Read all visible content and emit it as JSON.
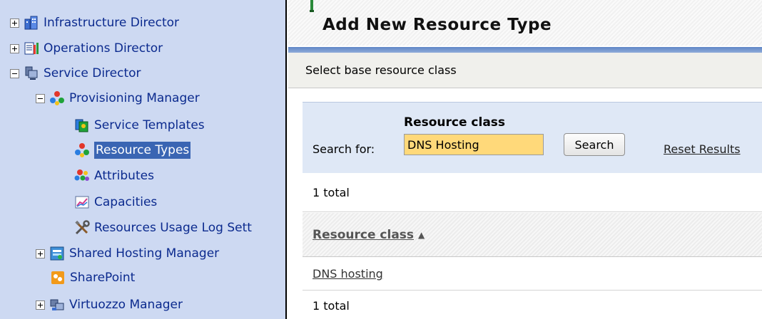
{
  "tree": {
    "items": [
      {
        "label": "Infrastructure Director",
        "icon": "building-icon"
      },
      {
        "label": "Operations Director",
        "icon": "operations-icon"
      },
      {
        "label": "Service Director",
        "icon": "service-director-icon"
      },
      {
        "label": "Provisioning Manager",
        "icon": "provisioning-icon"
      },
      {
        "label": "Service Templates",
        "icon": "service-templates-icon"
      },
      {
        "label": "Resource Types",
        "icon": "resource-types-icon"
      },
      {
        "label": "Attributes",
        "icon": "attributes-icon"
      },
      {
        "label": "Capacities",
        "icon": "chart-icon"
      },
      {
        "label": "Resources Usage Log Sett",
        "icon": "tools-icon"
      },
      {
        "label": "Shared Hosting Manager",
        "icon": "shared-hosting-icon"
      },
      {
        "label": "SharePoint",
        "icon": "sharepoint-icon"
      },
      {
        "label": "Virtuozzo Manager",
        "icon": "virtuozzo-icon"
      }
    ],
    "selected": "Resource Types"
  },
  "main": {
    "title": "Add New Resource Type",
    "instruction": "Select base resource class",
    "search": {
      "column_label": "Resource class",
      "search_for_label": "Search for:",
      "value": "DNS Hosting",
      "button_label": "Search",
      "reset_label": "Reset Results"
    },
    "total_top": "1 total",
    "table": {
      "column_header": "Resource class",
      "sort_indicator": "▲",
      "rows": [
        "DNS hosting"
      ]
    },
    "total_bottom": "1 total"
  },
  "colors": {
    "tree_background": "#cdd9f2",
    "tree_link": "#0b2a8e",
    "selection": "#3a65b3",
    "search_field": "#ffd97a",
    "search_area": "#dfe8f6"
  }
}
